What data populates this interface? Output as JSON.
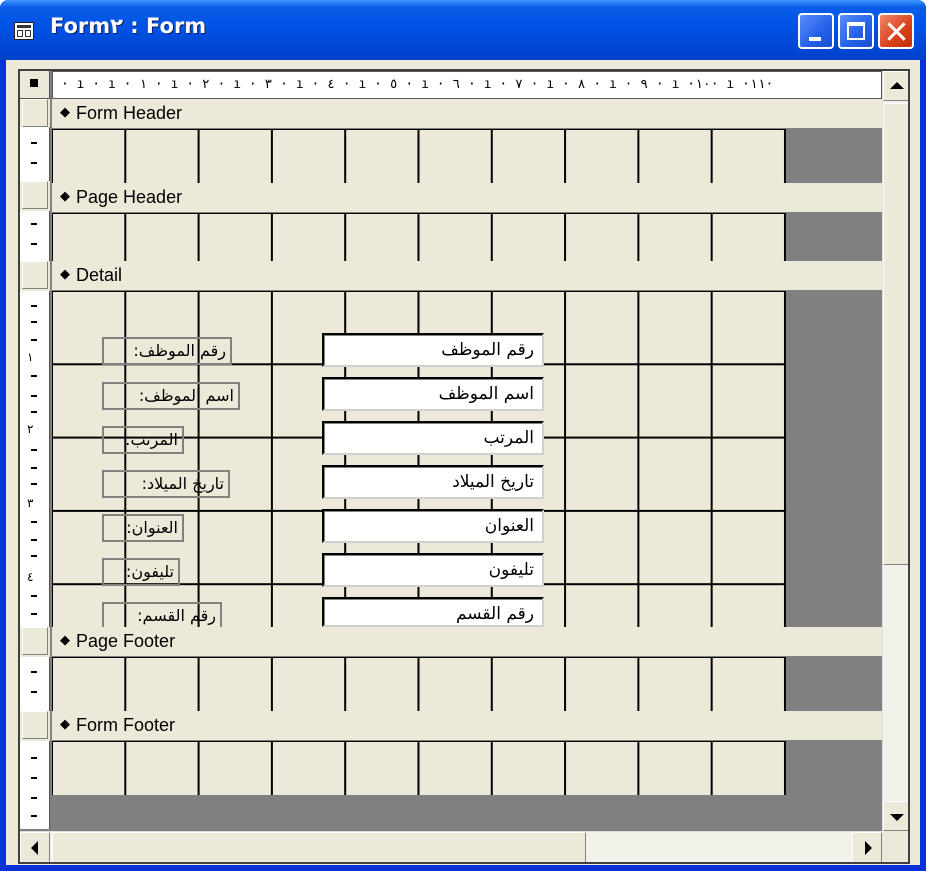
{
  "window": {
    "title": "Form٢ : Form",
    "icon": "form-design-icon",
    "caption_buttons": [
      "minimize-icon",
      "maximize-icon",
      "close-icon"
    ]
  },
  "ruler": {
    "horizontal_text": "· ı · ı · ١ · ı · ٢ · ı · ٣ · ı · ٤ · ı · ٥ · ı · ٦ · ı · ٧ · ı · ٨ · ı · ٩ · ı ·١٠· ı ·١١·",
    "vertical_numbers": [
      "١",
      "٢",
      "٣",
      "٤"
    ]
  },
  "sections": {
    "form_header": "Form Header",
    "page_header": "Page Header",
    "detail": "Detail",
    "page_footer": "Page Footer",
    "form_footer": "Form Footer",
    "section_icon": "section-marker-icon"
  },
  "fields": [
    {
      "label": "رقم الموظف:",
      "value": "رقم الموظف"
    },
    {
      "label": "اسم الموظف:",
      "value": "اسم الموظف"
    },
    {
      "label": "المرتب:",
      "value": "المرتب"
    },
    {
      "label": "تاريخ الميلاد:",
      "value": "تاريخ الميلاد"
    },
    {
      "label": "العنوان:",
      "value": "العنوان"
    },
    {
      "label": "تليفون:",
      "value": "تليفون"
    },
    {
      "label": "رقم القسم:",
      "value": "رقم القسم"
    }
  ],
  "colors": {
    "titlebar": "#0052e5",
    "grid_background": "#ece9d8",
    "outside_area": "#808080"
  }
}
